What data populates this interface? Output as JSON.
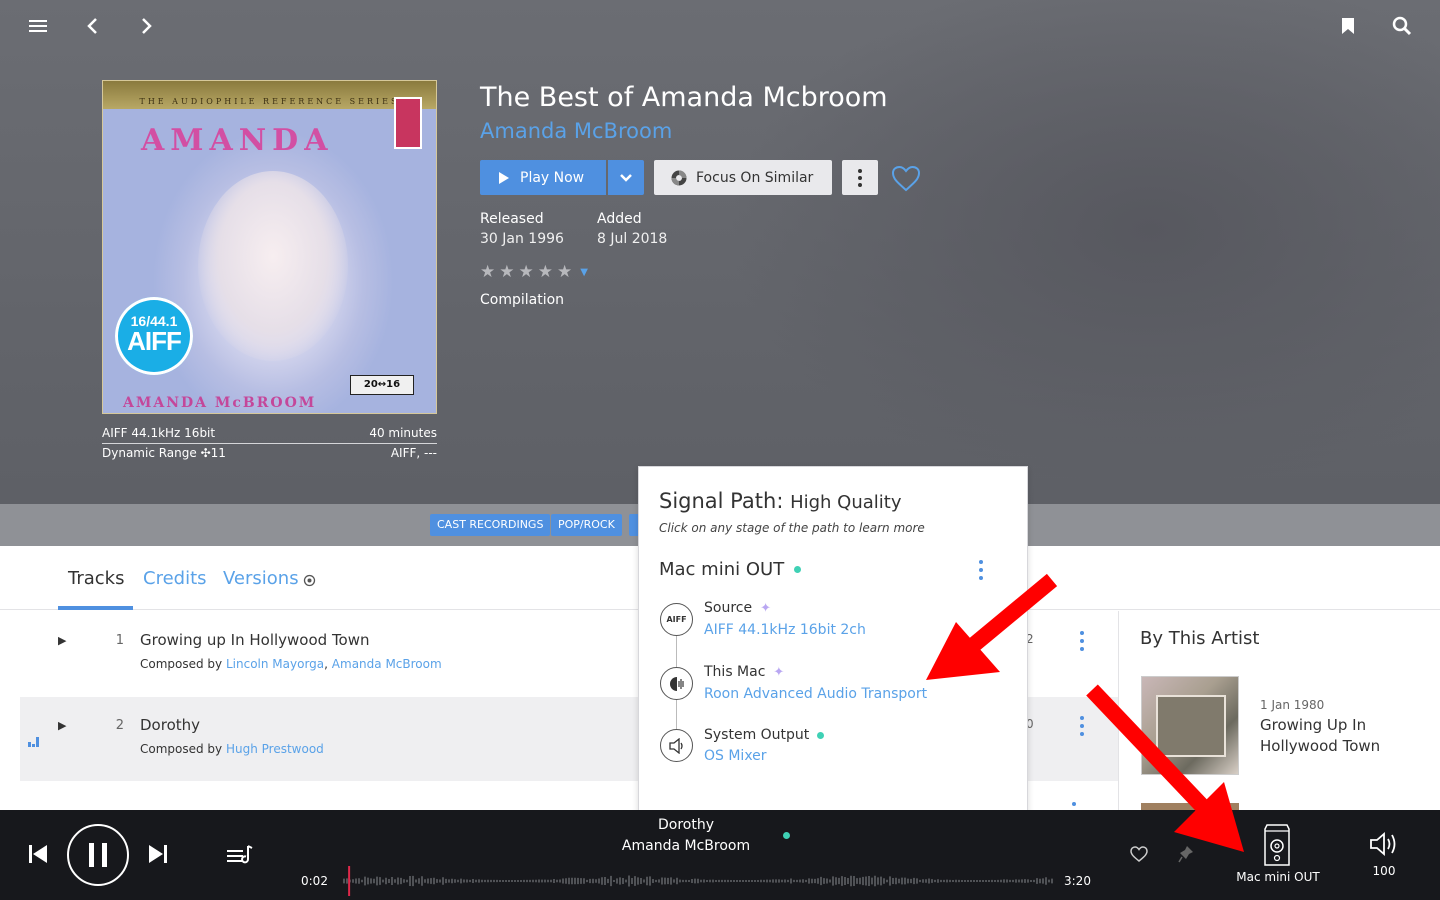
{
  "topbar": {
    "menu_icon": "hamburger-icon",
    "back_icon": "chevron-left-icon",
    "forward_icon": "chevron-right-icon",
    "bookmark_icon": "bookmark-icon",
    "search_icon": "search-icon"
  },
  "cover": {
    "series_text": "THE AUDIOPHILE REFERENCE SERIES",
    "title_text": "AMANDA",
    "artist_text": "AMANDA McBROOM",
    "badge_top": "16/44.1",
    "badge_bottom": "AIFF",
    "logo_text": "20↔16"
  },
  "cover_meta": {
    "format": "AIFF 44.1kHz 16bit",
    "duration": "40 minutes",
    "dynamic_range": "Dynamic Range ✣11",
    "file_type": "AIFF, ---"
  },
  "album": {
    "title": "The Best of Amanda Mcbroom",
    "artist": "Amanda McBroom",
    "play_now": "Play Now",
    "focus_on_similar": "Focus On Similar",
    "released_label": "Released",
    "released_value": "30 Jan 1996",
    "added_label": "Added",
    "added_value": "8 Jul 2018",
    "rating": 0,
    "rating_max": 5,
    "compilation": "Compilation"
  },
  "genres": [
    "CAST RECORDINGS",
    "POP/ROCK"
  ],
  "tabs": {
    "tracks": "Tracks",
    "credits": "Credits",
    "versions": "Versions"
  },
  "tracks": [
    {
      "number": "1",
      "title": "Growing up In Hollywood Town",
      "composed_by_label": "Composed by",
      "composers": [
        "Lincoln Mayorga",
        "Amanda McBroom"
      ],
      "duration_fragment": "2"
    },
    {
      "number": "2",
      "title": "Dorothy",
      "composed_by_label": "Composed by",
      "composers": [
        "Hugh Prestwood"
      ],
      "duration_fragment": "0"
    }
  ],
  "sidebar": {
    "heading": "By This Artist",
    "album_date": "1 Jan 1980",
    "album_title": "Growing Up In Hollywood Town"
  },
  "signal_path": {
    "title": "Signal Path:",
    "quality": "High Quality",
    "subtitle": "Click on any stage of the path to learn more",
    "zone": "Mac mini OUT",
    "stages": [
      {
        "icon": "aiff-icon",
        "icon_text": "AIFF",
        "name": "Source",
        "detail": "AIFF 44.1kHz 16bit 2ch"
      },
      {
        "icon": "raat-icon",
        "name": "This Mac",
        "detail": "Roon Advanced Audio Transport"
      },
      {
        "icon": "speaker-icon",
        "name": "System Output",
        "detail": "OS Mixer"
      }
    ]
  },
  "player": {
    "now_playing_title": "Dorothy",
    "now_playing_artist": "Amanda McBroom",
    "elapsed": "0:02",
    "total": "3:20",
    "progress": 0.01,
    "zone_label": "Mac mini OUT",
    "volume": "100"
  },
  "colors": {
    "accent": "#4f90e0",
    "link": "#5aa2e8",
    "quality_dot": "#3fd1b5",
    "player_bg": "#17181c",
    "annotation_arrow": "#ff0000"
  }
}
